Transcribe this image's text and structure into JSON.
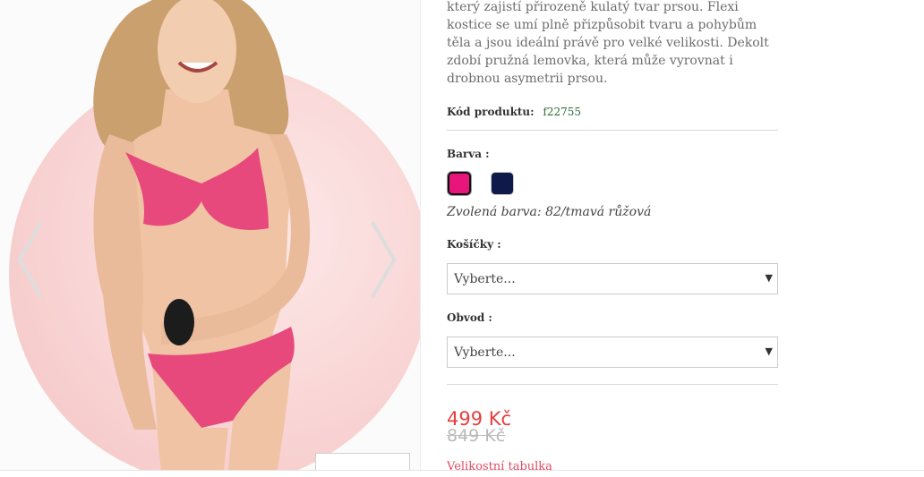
{
  "gallery": {
    "image": "product-model-photo",
    "prev_icon": "chevron-left-icon",
    "next_icon": "chevron-right-icon"
  },
  "product": {
    "description": "který zajistí přirozeně kulatý tvar prsou. Flexi kostice se umí plně přizpůsobit tvaru a pohybům těla a jsou ideální právě pro velké velikosti. Dekolt zdobí pružná lemovka, která může vyrovnat i drobnou asymetrii prsou.",
    "code_label": "Kód produktu:",
    "code_value": "f22755",
    "color_label": "Barva :",
    "colors": [
      {
        "name": "tmavá růžová",
        "hex": "#e8157a",
        "selected": true
      },
      {
        "name": "tmavě modrá",
        "hex": "#0f1a4a",
        "selected": false
      }
    ],
    "chosen_color": "Zvolená barva: 82/tmavá růžová",
    "cups_label": "Košíčky :",
    "cups_value": "Vyberte...",
    "band_label": "Obvod :",
    "band_value": "Vyberte...",
    "price": "499 Kč",
    "old_price": "849 Kč",
    "size_chart_link": "Velikostní tabulka"
  },
  "colors": {
    "price": "#e4403f",
    "link": "#e04a62",
    "code": "#2e6b3a"
  }
}
